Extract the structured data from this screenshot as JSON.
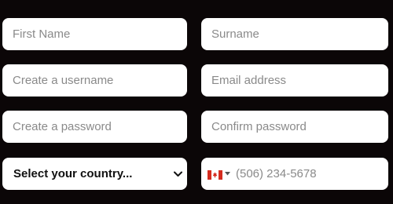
{
  "form": {
    "first_name": {
      "placeholder": "First Name",
      "value": ""
    },
    "surname": {
      "placeholder": "Surname",
      "value": ""
    },
    "username": {
      "placeholder": "Create a username",
      "value": ""
    },
    "email": {
      "placeholder": "Email address",
      "value": ""
    },
    "password": {
      "placeholder": "Create a password",
      "value": ""
    },
    "confirm_password": {
      "placeholder": "Confirm password",
      "value": ""
    },
    "country": {
      "selected": "Select your country..."
    },
    "phone": {
      "country_flag": "canada-flag-icon",
      "placeholder": "(506) 234-5678",
      "value": ""
    }
  },
  "colors": {
    "background": "#0b0607",
    "field_background": "#ffffff",
    "placeholder_text": "#8a8a8a",
    "select_text": "#111111",
    "flag_red": "#d52b1e"
  }
}
